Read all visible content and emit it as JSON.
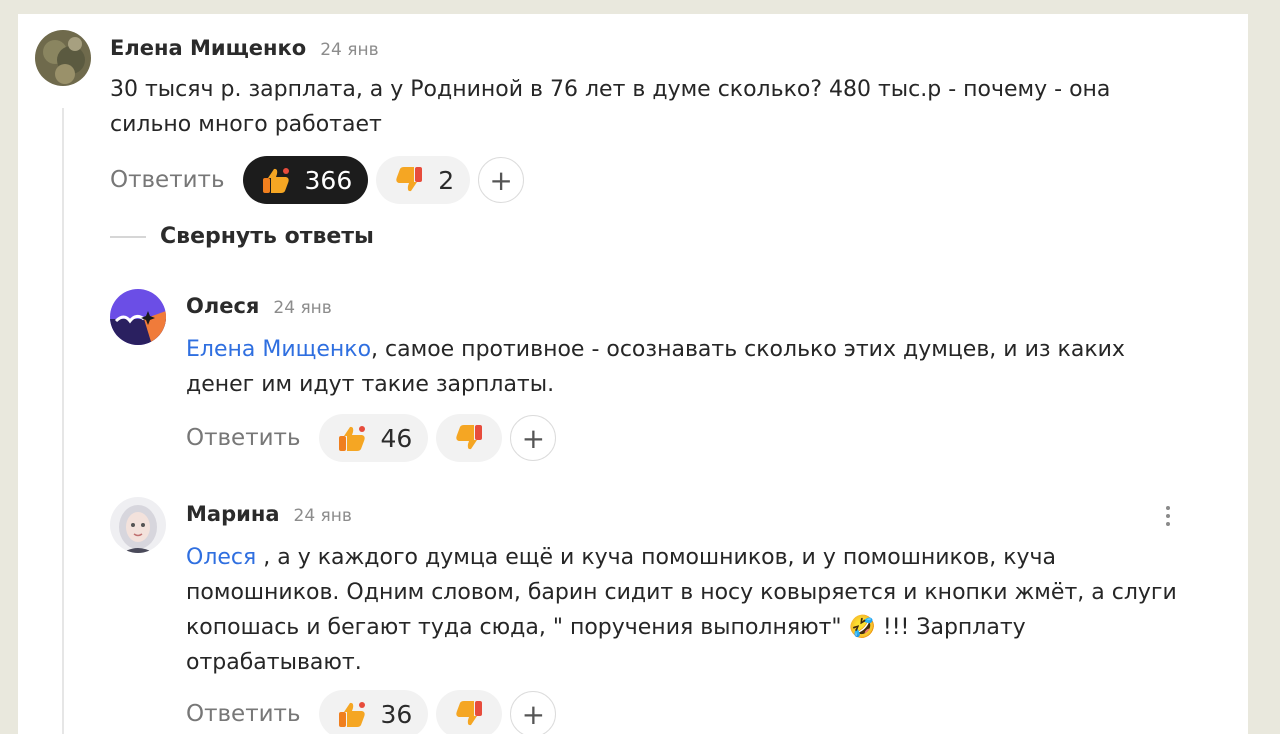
{
  "comments": [
    {
      "author": "Елена Мищенко",
      "date": "24 янв",
      "text": "30 тысяч р. зарплата, а у Родниной в 76 лет в думе сколько? 480 тыс.р - почему - она сильно много работает",
      "reply_label": "Ответить",
      "likes": "366",
      "dislikes": "2"
    },
    {
      "author": "Олеся",
      "date": "24 янв",
      "mention": "Елена Мищенко",
      "text": ", самое противное - осознавать сколько этих думцев, и из каких денег им идут такие зарплаты.",
      "reply_label": "Ответить",
      "likes": "46",
      "dislikes": ""
    },
    {
      "author": "Марина",
      "date": "24 янв",
      "mention": "Олеся",
      "text": " , а у каждого думца ещё и куча помошников, и у помошников, куча помошников. Одним словом, барин сидит в носу ковыряется и кнопки жмёт, а слуги копошась и бегают туда сюда, \" поручения выполняют\" 🤣 !!! Зарплату отрабатывают.",
      "reply_label": "Ответить",
      "likes": "36",
      "dislikes": ""
    }
  ],
  "collapse_label": "Свернуть ответы",
  "plus_symbol": "+",
  "colors": {
    "mention": "#2f6fe0",
    "liked_pill": "#1c1c1c",
    "pill": "#f2f2f2"
  }
}
